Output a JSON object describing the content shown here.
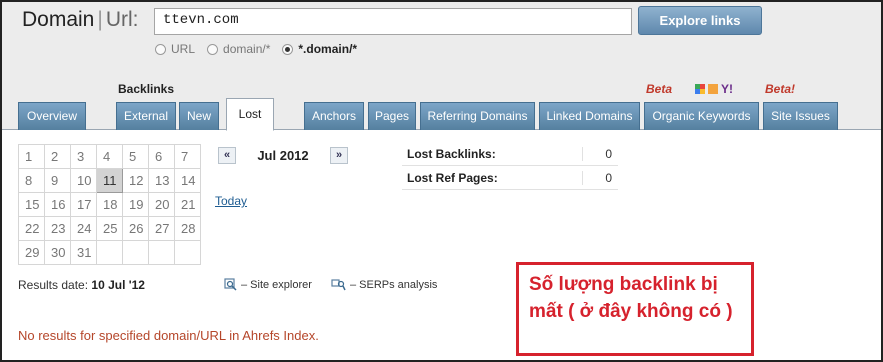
{
  "header": {
    "brand_domain": "Domain",
    "brand_sep": "|",
    "brand_url": "Url:",
    "url_value": "ttevn.com",
    "explore_label": "Explore links"
  },
  "radio_options": [
    {
      "label": "URL",
      "selected": false
    },
    {
      "label": "domain/*",
      "selected": false
    },
    {
      "label": "*.domain/*",
      "selected": true
    }
  ],
  "backlinks_label": "Backlinks",
  "beta_labels": [
    "Beta",
    "Beta!"
  ],
  "search_engine_icons": [
    "google-icon",
    "bing-icon",
    "yahoo-icon"
  ],
  "yahoo_glyph": "Y!",
  "tabs": [
    {
      "label": "Overview",
      "active": false
    },
    {
      "label": "External",
      "active": false
    },
    {
      "label": "New",
      "active": false
    },
    {
      "label": "Lost",
      "active": true
    },
    {
      "label": "Anchors",
      "active": false
    },
    {
      "label": "Pages",
      "active": false
    },
    {
      "label": "Referring Domains",
      "active": false
    },
    {
      "label": "Linked Domains",
      "active": false
    },
    {
      "label": "Organic Keywords",
      "active": false
    },
    {
      "label": "Site Issues",
      "active": false
    }
  ],
  "calendar": {
    "month": "Jul 2012",
    "prev": "«",
    "next": "»",
    "selected_day": "11",
    "weeks": [
      [
        "1",
        "2",
        "3",
        "4",
        "5",
        "6",
        "7"
      ],
      [
        "8",
        "9",
        "10",
        "11",
        "12",
        "13",
        "14"
      ],
      [
        "15",
        "16",
        "17",
        "18",
        "19",
        "20",
        "21"
      ],
      [
        "22",
        "23",
        "24",
        "25",
        "26",
        "27",
        "28"
      ],
      [
        "29",
        "30",
        "31",
        "",
        "",
        "",
        ""
      ]
    ]
  },
  "today_link": "Today",
  "stats": [
    {
      "label": "Lost Backlinks:",
      "value": "0"
    },
    {
      "label": "Lost Ref Pages:",
      "value": "0"
    }
  ],
  "results_date": {
    "label": "Results date:",
    "value": "10 Jul '12"
  },
  "tools": {
    "site_explorer": "– Site explorer",
    "serps_analysis": "– SERPs analysis"
  },
  "no_results": "No results for specified domain/URL in Ahrefs Index.",
  "annotation": "Số lượng backlink bị mất ( ở đây không có )",
  "colors": {
    "tab_blue": "#6a93b6",
    "beta_red": "#c0392b",
    "annotation_red": "#d6222d",
    "no_results": "#b5462a",
    "link": "#1f5d92"
  }
}
